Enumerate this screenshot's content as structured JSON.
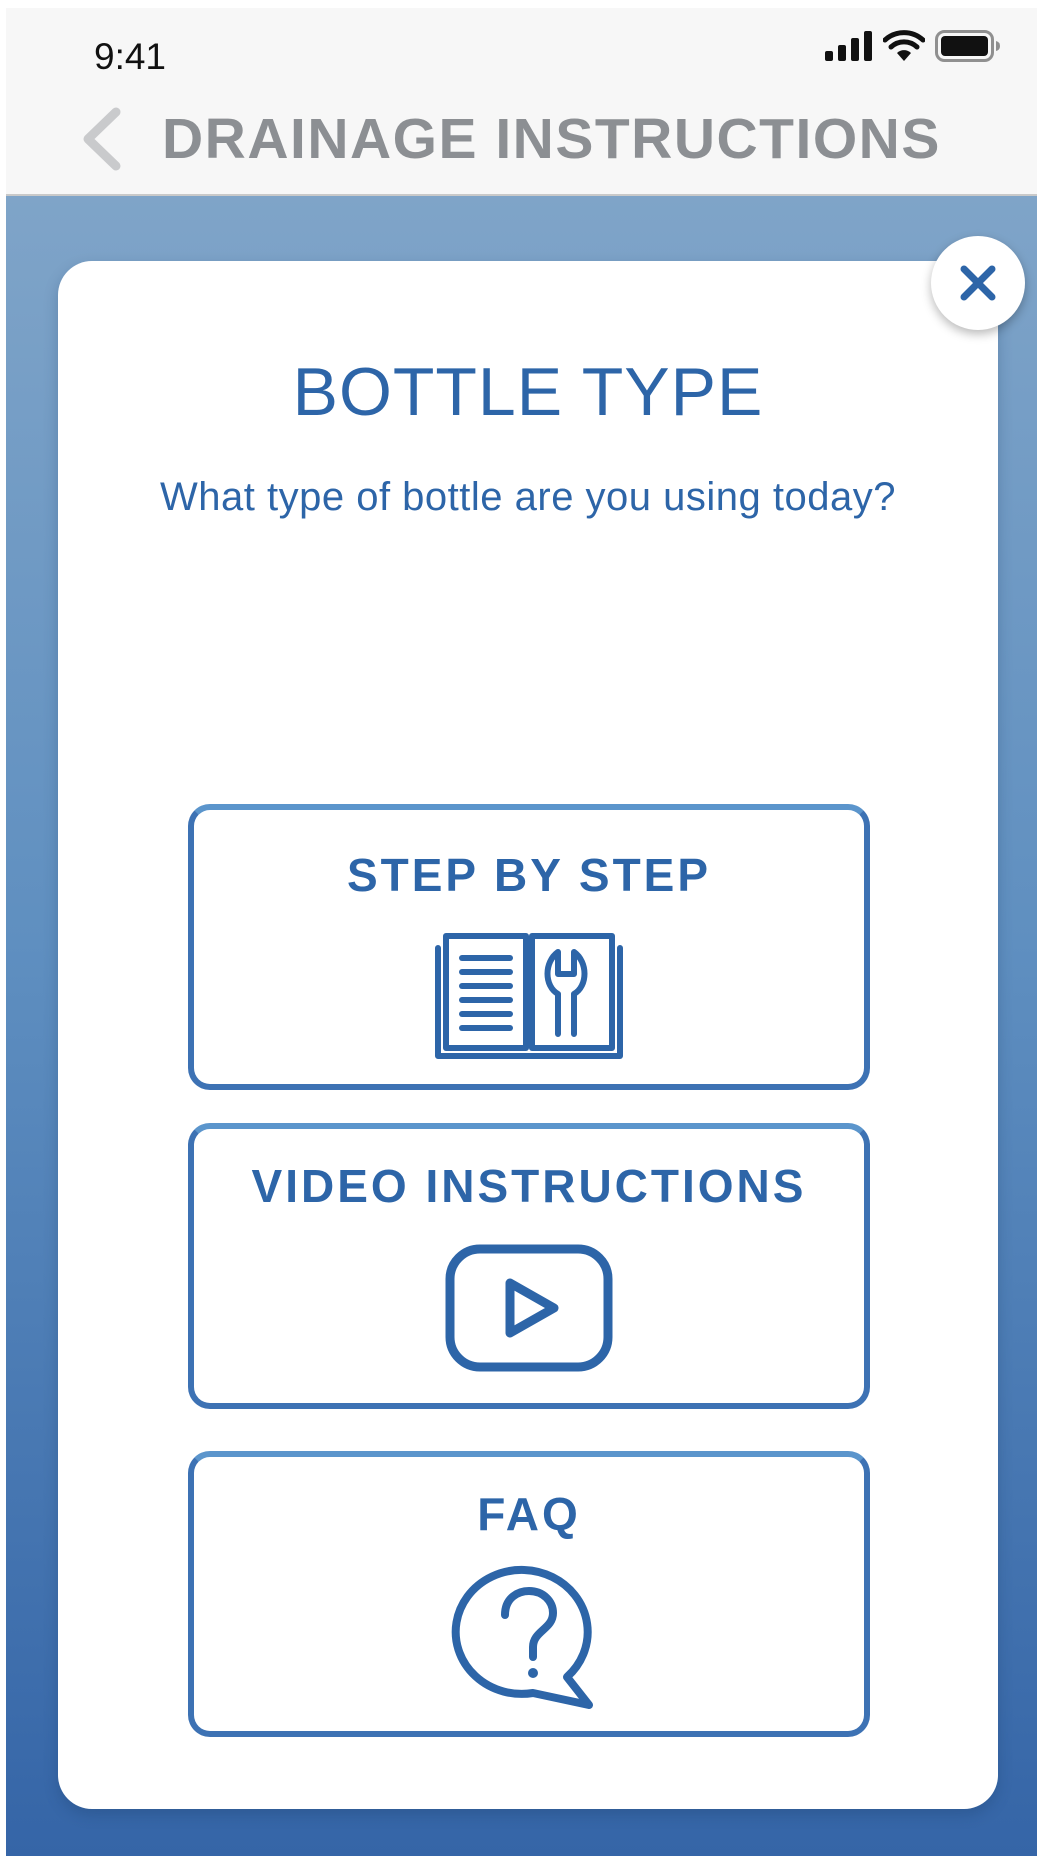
{
  "status_bar": {
    "time": "9:41",
    "icons": [
      "cellular-signal-icon",
      "wifi-icon",
      "battery-icon"
    ]
  },
  "nav": {
    "back_icon": "chevron-left-icon",
    "title": "DRAINAGE INSTRUCTIONS"
  },
  "modal": {
    "title": "BOTTLE TYPE",
    "subtitle": "What type of bottle are you using today?",
    "close_icon": "close-icon",
    "options": [
      {
        "label": "STEP BY STEP",
        "icon": "manual-book-wrench-icon"
      },
      {
        "label": "VIDEO INSTRUCTIONS",
        "icon": "play-video-icon"
      },
      {
        "label": "FAQ",
        "icon": "question-bubble-icon"
      }
    ]
  },
  "colors": {
    "accent": "#2d65a8",
    "nav_title": "#8c8f93",
    "background_top": "#7fa4c8",
    "background_bottom": "#3565a7",
    "card": "#ffffff"
  }
}
